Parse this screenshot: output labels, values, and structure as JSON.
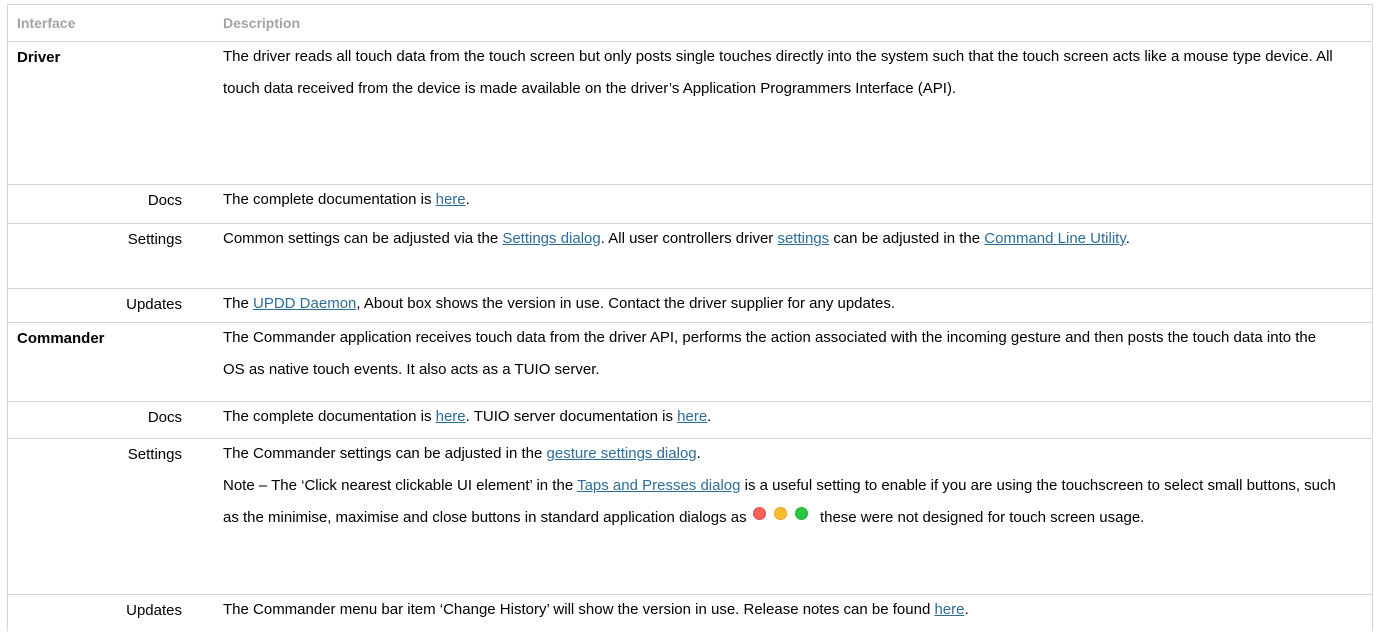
{
  "header": {
    "col1": "Interface",
    "col2": "Description"
  },
  "driver": {
    "name": "Driver",
    "description": "The driver reads all touch data from the touch screen but only posts single touches directly into the system such that the touch screen acts like a mouse type device. All touch data received from the device is made available on the driver’s Application Programmers Interface (API).",
    "docs": {
      "label": "Docs",
      "text_before": "The complete documentation is ",
      "link": "here",
      "text_after": "."
    },
    "settings": {
      "label": "Settings",
      "t1": "Common settings can be adjusted via the ",
      "link1": "Settings dialog",
      "t2": ". All user controllers driver ",
      "link2": "settings",
      "t3": " can be adjusted in the ",
      "link3": "Command Line Utility",
      "t4": "."
    },
    "updates": {
      "label": "Updates",
      "t1": "The ",
      "link": "UPDD Daemon",
      "t2": ", About box shows the version in use. Contact the driver supplier for any updates."
    }
  },
  "commander": {
    "name": "Commander",
    "description": "The Commander application receives touch data from the driver API, performs the action associated with the incoming gesture and then posts the touch data into the OS as native touch events. It also acts as a TUIO server.",
    "docs": {
      "label": "Docs",
      "t1": "The complete documentation is ",
      "link1": "here",
      "t2": ". TUIO server documentation is ",
      "link2": "here",
      "t3": "."
    },
    "settings": {
      "label": "Settings",
      "t1": "The Commander settings can be adjusted in the ",
      "link1": "gesture settings dialog",
      "t2": ".",
      "note1": "Note – The ‘Click nearest clickable UI element’ in the ",
      "note_link": "Taps and Presses dialog",
      "note2": " is a useful setting to enable if you are using the touchscreen to select small buttons, such as the minimise, maximise and close buttons in standard application dialogs as ",
      "note3": " these were not designed for touch screen usage."
    },
    "updates": {
      "label": "Updates",
      "t1": "The Commander menu bar item ‘Change History’ will show the version in use. Release notes can be found ",
      "link": "here",
      "t2": "."
    }
  },
  "colors": {
    "link": "#2e6c98",
    "header_text": "#a3a3a3",
    "border": "#d4d4d4",
    "dot_red": "#fc5f57",
    "dot_yellow": "#fdbb2e",
    "dot_green": "#28c840"
  }
}
